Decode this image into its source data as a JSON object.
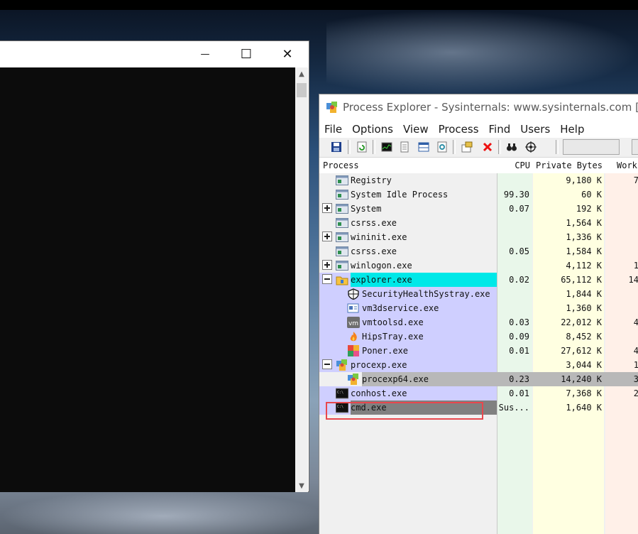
{
  "console_window": {
    "minimize_glyph": "—",
    "maximize_glyph": "☐",
    "close_glyph": "✕",
    "scroll_up_glyph": "▲",
    "scroll_down_glyph": "▼"
  },
  "procexp": {
    "title": "Process Explorer - Sysinternals: www.sysinternals.com [ZY",
    "menu": [
      "File",
      "Options",
      "View",
      "Process",
      "Find",
      "Users",
      "Help"
    ],
    "toolbar_icons": [
      "save-icon",
      "refresh-icon",
      "cpu-graph-icon",
      "properties-icon",
      "window-icon",
      "find-dll-icon",
      "handles-icon",
      "kill-process-icon",
      "find-icon",
      "target-icon"
    ],
    "columns": {
      "process": "Process",
      "cpu": "CPU",
      "private_bytes": "Private Bytes",
      "working_set": "Worki"
    },
    "colors": {
      "own_process": "#cfcfff",
      "service_new": "#00e8e8",
      "selected": "#808080",
      "cpu_column": "#e9f7ea",
      "private_bytes_column": "#ffffe1",
      "working_set_column": "#fff0e8",
      "highlight_box": "#e8474d"
    },
    "processes": [
      {
        "name": "Registry",
        "cpu": "",
        "private_bytes": "9,180 K",
        "working_set": "7"
      },
      {
        "name": "System Idle Process",
        "cpu": "99.30",
        "private_bytes": "60 K",
        "working_set": ""
      },
      {
        "name": "System",
        "cpu": "0.07",
        "private_bytes": "192 K",
        "working_set": ""
      },
      {
        "name": "csrss.exe",
        "cpu": "",
        "private_bytes": "1,564 K",
        "working_set": ""
      },
      {
        "name": "wininit.exe",
        "cpu": "",
        "private_bytes": "1,336 K",
        "working_set": ""
      },
      {
        "name": "csrss.exe",
        "cpu": "0.05",
        "private_bytes": "1,584 K",
        "working_set": ""
      },
      {
        "name": "winlogon.exe",
        "cpu": "",
        "private_bytes": "4,112 K",
        "working_set": "1"
      },
      {
        "name": "explorer.exe",
        "cpu": "0.02",
        "private_bytes": "65,112 K",
        "working_set": "14"
      },
      {
        "name": "SecurityHealthSystray.exe",
        "cpu": "",
        "private_bytes": "1,844 K",
        "working_set": ""
      },
      {
        "name": "vm3dservice.exe",
        "cpu": "",
        "private_bytes": "1,360 K",
        "working_set": ""
      },
      {
        "name": "vmtoolsd.exe",
        "cpu": "0.03",
        "private_bytes": "22,012 K",
        "working_set": "4"
      },
      {
        "name": "HipsTray.exe",
        "cpu": "0.09",
        "private_bytes": "8,452 K",
        "working_set": ""
      },
      {
        "name": "Poner.exe",
        "cpu": "0.01",
        "private_bytes": "27,612 K",
        "working_set": "4"
      },
      {
        "name": "procexp.exe",
        "cpu": "",
        "private_bytes": "3,044 K",
        "working_set": "1"
      },
      {
        "name": "procexp64.exe",
        "cpu": "0.23",
        "private_bytes": "14,240 K",
        "working_set": "3"
      },
      {
        "name": "conhost.exe",
        "cpu": "0.01",
        "private_bytes": "7,368 K",
        "working_set": "2"
      },
      {
        "name": "cmd.exe",
        "cpu": "Sus...",
        "private_bytes": "1,640 K",
        "working_set": ""
      }
    ]
  }
}
